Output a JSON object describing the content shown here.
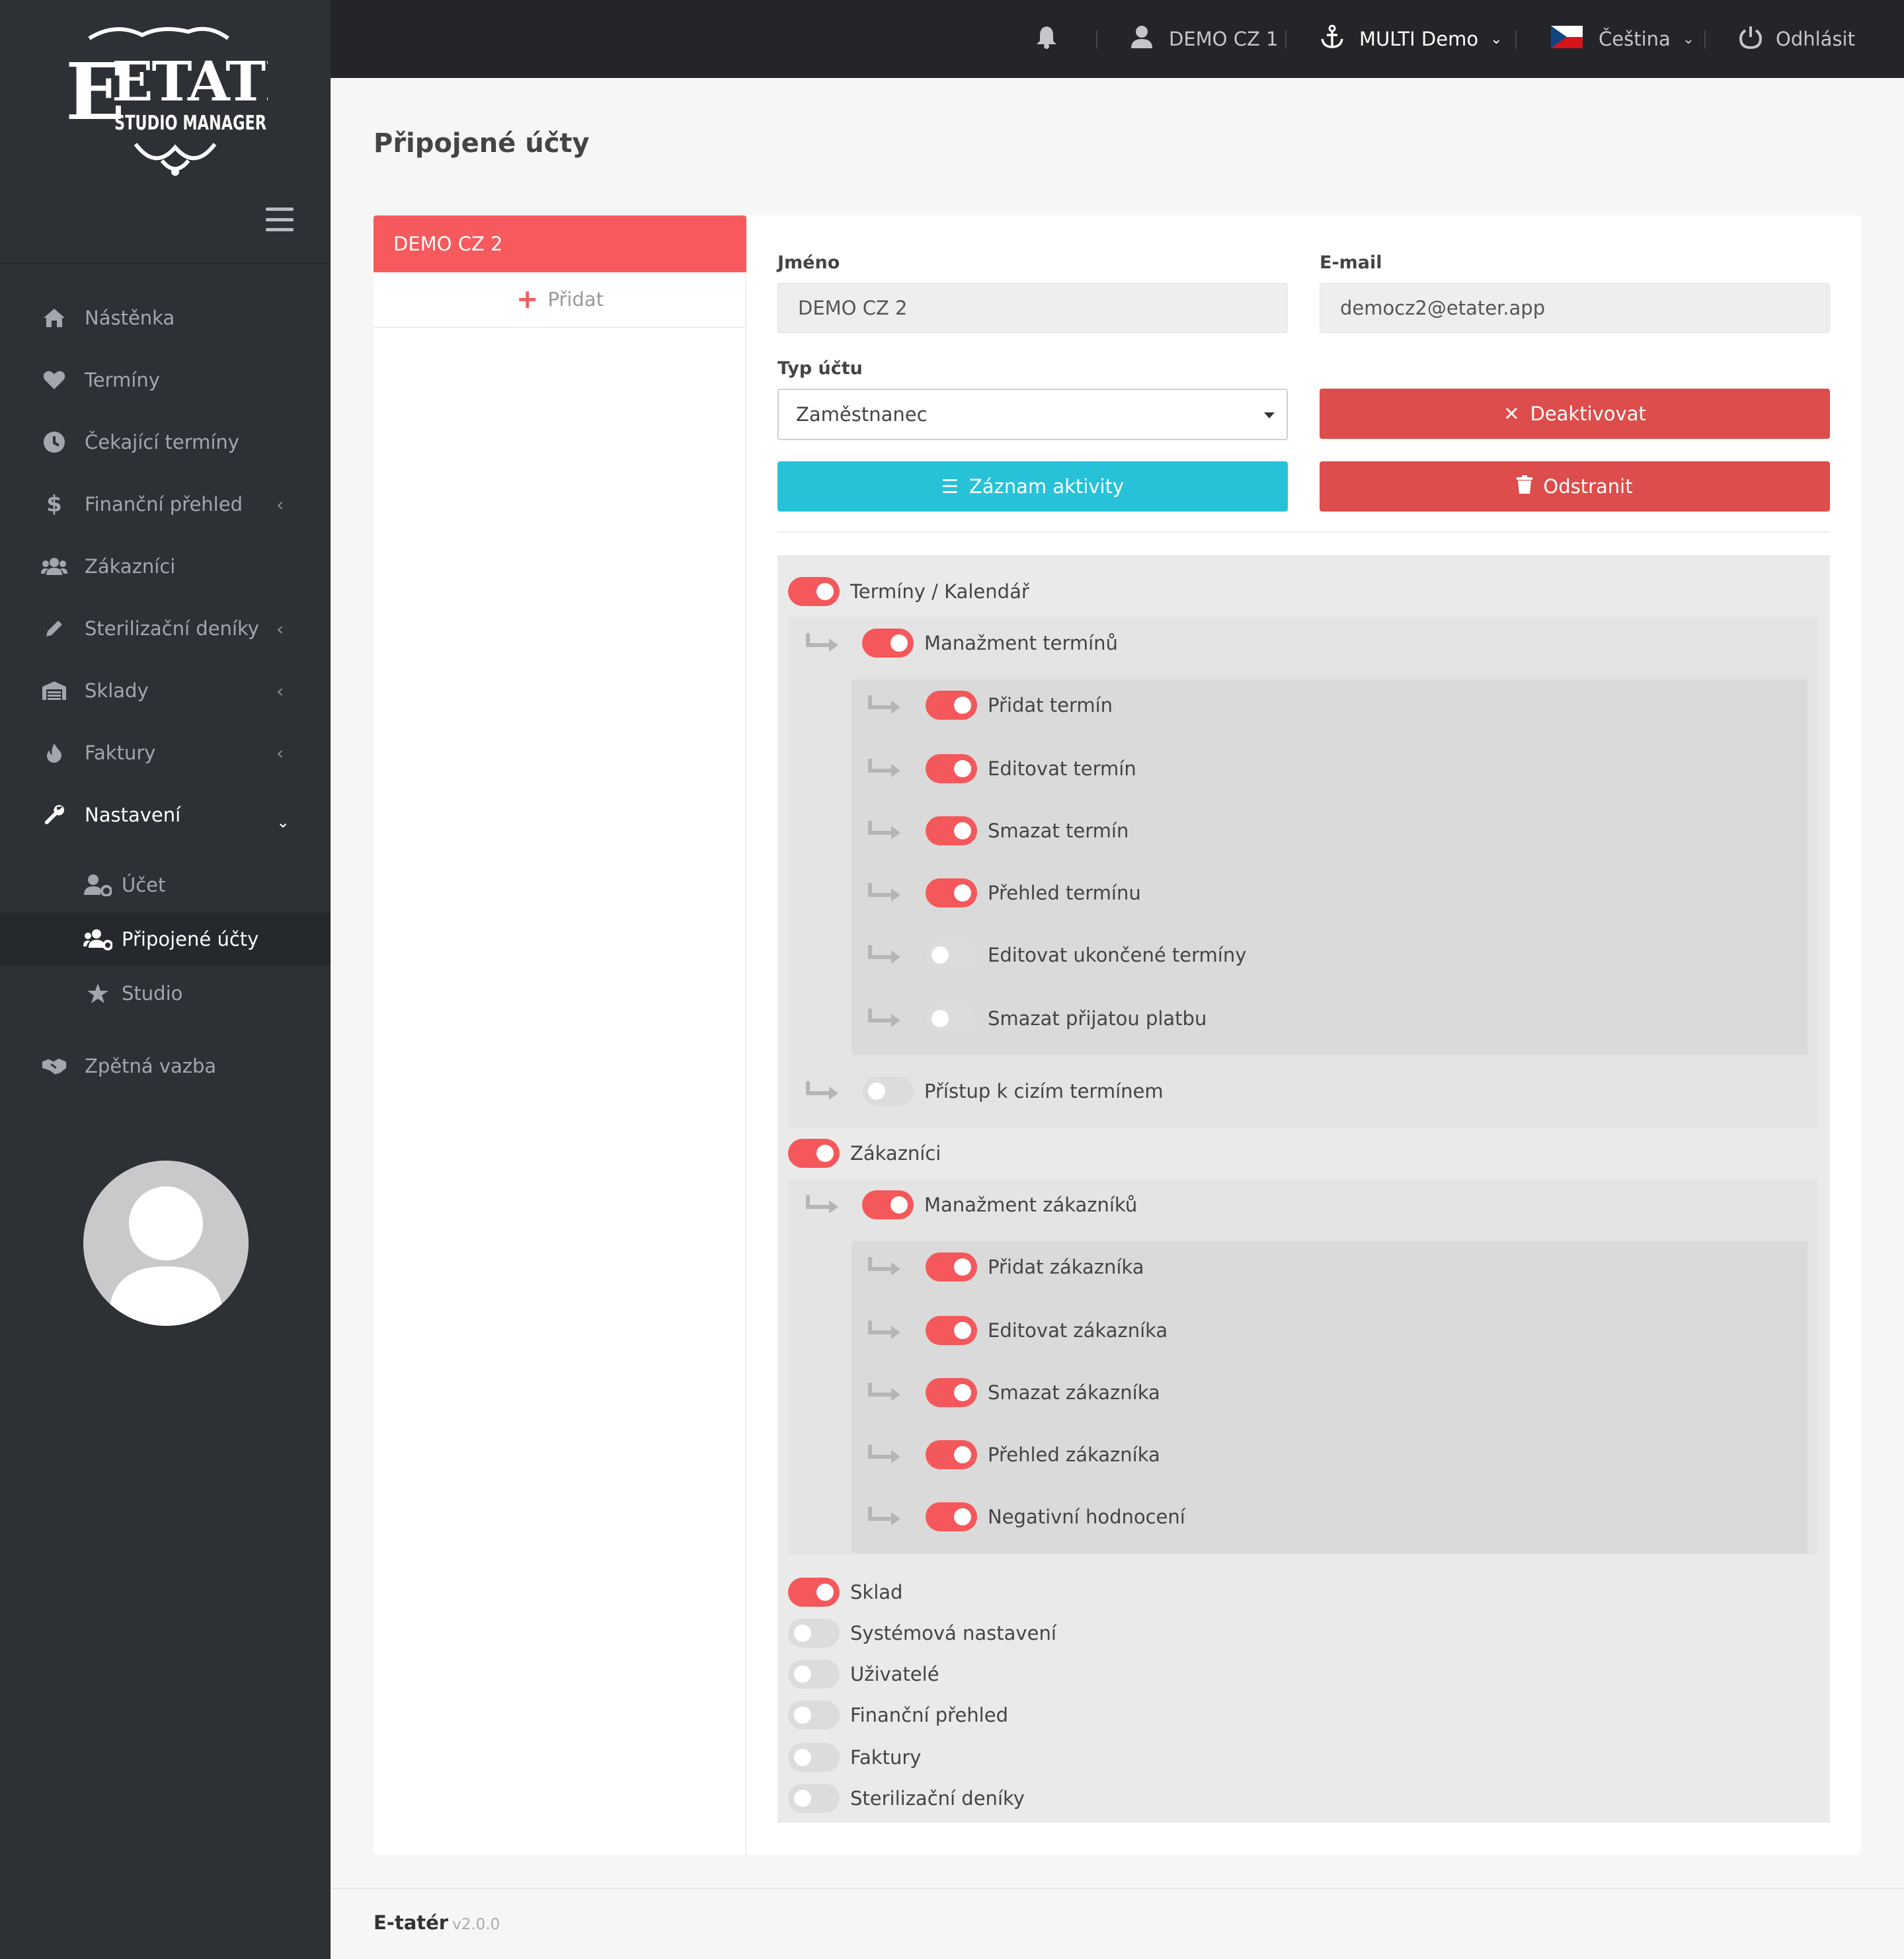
{
  "brand": {
    "logo_line1": "ETATÉR",
    "logo_line2": "STUDIO MANAGER"
  },
  "topbar": {
    "user": "DEMO CZ 1",
    "studio": "MULTI Demo",
    "language": "Čeština",
    "logout": "Odhlásit"
  },
  "sidebar": {
    "items": [
      {
        "label": "Nástěnka",
        "icon": "home-icon"
      },
      {
        "label": "Termíny",
        "icon": "heart-icon"
      },
      {
        "label": "Čekající termíny",
        "icon": "clock-icon"
      },
      {
        "label": "Finanční přehled",
        "icon": "dollar-icon"
      },
      {
        "label": "Zákazníci",
        "icon": "users-icon"
      },
      {
        "label": "Sterilizační deníky",
        "icon": "pencil-icon"
      },
      {
        "label": "Sklady",
        "icon": "warehouse-icon"
      },
      {
        "label": "Faktury",
        "icon": "fire-icon"
      },
      {
        "label": "Nastavení",
        "icon": "wrench-icon"
      }
    ],
    "sub_items": [
      {
        "label": "Účet",
        "icon": "user-cog-icon"
      },
      {
        "label": "Připojené účty",
        "icon": "users-cog-icon"
      },
      {
        "label": "Studio",
        "icon": "star-icon"
      }
    ],
    "feedback": {
      "label": "Zpětná vazba",
      "icon": "handshake-icon"
    }
  },
  "page": {
    "title": "Připojené účty"
  },
  "accounts": {
    "active": "DEMO CZ 2",
    "add_label": "Přidat"
  },
  "form": {
    "name_label": "Jméno",
    "name_value": "DEMO CZ 2",
    "email_label": "E-mail",
    "email_value": "democz2@etater.app",
    "type_label": "Typ účtu",
    "type_value": "Zaměstnanec",
    "deactivate": "Deaktivovat",
    "activity": "Záznam aktivity",
    "delete": "Odstranit"
  },
  "permissions": {
    "appointments": {
      "label": "Termíny / Kalendář",
      "on": true
    },
    "appt_mgmt": {
      "label": "Manažment termínů",
      "on": true
    },
    "appt_children": [
      {
        "label": "Přidat termín",
        "on": true
      },
      {
        "label": "Editovat termín",
        "on": true
      },
      {
        "label": "Smazat termín",
        "on": true
      },
      {
        "label": "Přehled termínu",
        "on": true
      },
      {
        "label": "Editovat ukončené termíny",
        "on": false
      },
      {
        "label": "Smazat přijatou platbu",
        "on": false
      }
    ],
    "foreign_access": {
      "label": "Přístup k cizím termínem",
      "on": false
    },
    "customers": {
      "label": "Zákazníci",
      "on": true
    },
    "cust_mgmt": {
      "label": "Manažment zákazníků",
      "on": true
    },
    "cust_children": [
      {
        "label": "Přidat zákazníka",
        "on": true
      },
      {
        "label": "Editovat zákazníka",
        "on": true
      },
      {
        "label": "Smazat zákazníka",
        "on": true
      },
      {
        "label": "Přehled zákazníka",
        "on": true
      },
      {
        "label": "Negativní hodnocení",
        "on": true
      }
    ],
    "top_level": [
      {
        "label": "Sklad",
        "on": true
      },
      {
        "label": "Systémová nastavení",
        "on": false
      },
      {
        "label": "Uživatelé",
        "on": false
      },
      {
        "label": "Finanční přehled",
        "on": false
      },
      {
        "label": "Faktury",
        "on": false
      },
      {
        "label": "Sterilizační deníky",
        "on": false
      }
    ]
  },
  "footer": {
    "brand": "E-tatér",
    "version": "v2.0.0"
  },
  "colors": {
    "accent": "#f65a5d",
    "danger": "#dd4d4b",
    "info": "#27c2d8",
    "sidebar": "#2d3035",
    "topbar": "#232528"
  }
}
